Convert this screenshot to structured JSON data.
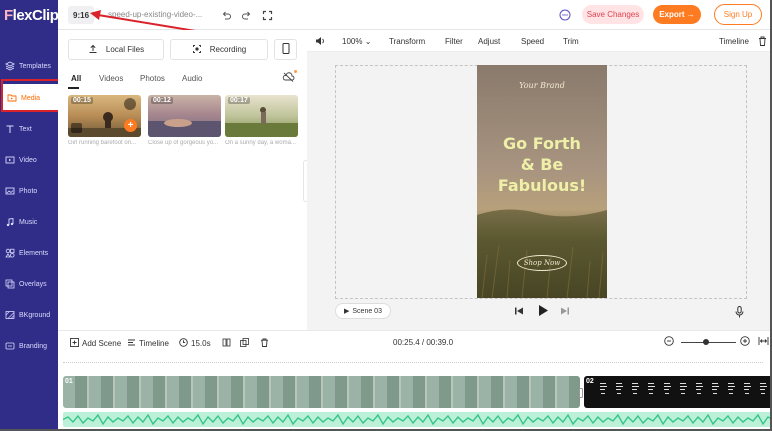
{
  "app": {
    "logo": "FlexClip"
  },
  "nav": {
    "items": [
      {
        "label": "Templates",
        "icon": "layers-icon"
      },
      {
        "label": "Media",
        "icon": "folder-icon"
      },
      {
        "label": "Text",
        "icon": "text-icon"
      },
      {
        "label": "Video",
        "icon": "video-icon"
      },
      {
        "label": "Photo",
        "icon": "photo-icon"
      },
      {
        "label": "Music",
        "icon": "music-icon"
      },
      {
        "label": "Elements",
        "icon": "elements-icon"
      },
      {
        "label": "Overlays",
        "icon": "overlays-icon"
      },
      {
        "label": "BKground",
        "icon": "background-icon"
      },
      {
        "label": "Branding",
        "icon": "branding-icon"
      }
    ],
    "active": "Media"
  },
  "topbar": {
    "ratio": "9:16",
    "project_title": "speed-up-existing-video-...",
    "save_label": "Save Changes",
    "export_label": "Export →",
    "signup_label": "Sign Up"
  },
  "media": {
    "local_files": "Local Files",
    "recording": "Recording",
    "tabs": [
      "All",
      "Videos",
      "Photos",
      "Audio"
    ],
    "thumbs": [
      {
        "duration": "00:15",
        "caption": "Girl running barefoot on..."
      },
      {
        "duration": "00:12",
        "caption": "Close up of gorgeous yo..."
      },
      {
        "duration": "00:17",
        "caption": "On a sunny day, a woma..."
      }
    ]
  },
  "toolbar": {
    "zoom": "100%",
    "items": [
      "Transform",
      "Filter",
      "Adjust",
      "Speed",
      "Trim"
    ],
    "timeline": "Timeline"
  },
  "preview": {
    "brand": "Your Brand",
    "headline_lines": [
      "Go Forth",
      "& Be",
      "Fabulous!"
    ],
    "cta": "Shop Now",
    "scene_label": "Scene 03"
  },
  "timeline_bar": {
    "add_scene": "Add Scene",
    "timeline": "Timeline",
    "duration": "15.0s",
    "time_display": "00:25.4 / 00:39.0"
  },
  "tracks": {
    "clip1": "01",
    "clip2": "02"
  },
  "colors": {
    "nav_bg": "#2f2d87",
    "accent": "#ff7b21",
    "save_bg": "#ffe3e5",
    "annotation_red": "#d9222a"
  }
}
